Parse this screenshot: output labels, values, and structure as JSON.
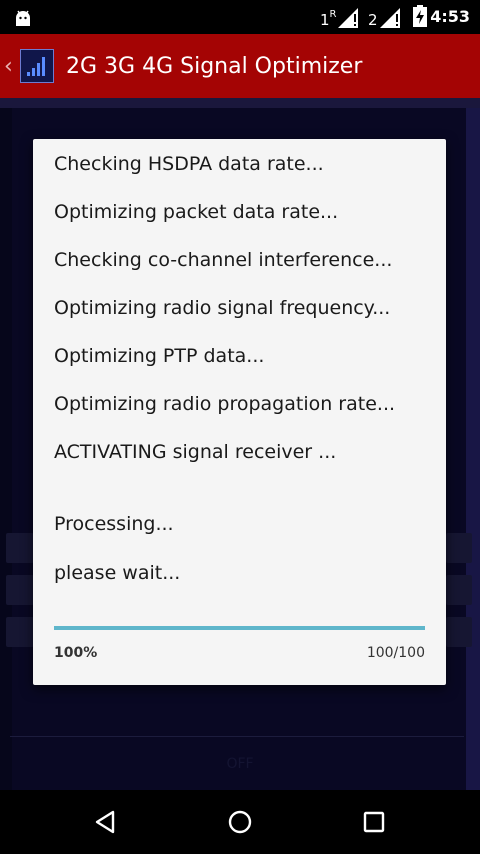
{
  "status_bar": {
    "sim1_label": "1",
    "sim1_roaming": "R",
    "sim2_label": "2",
    "time": "4:53"
  },
  "app_bar": {
    "back_glyph": "‹",
    "title": "2G 3G 4G Signal Optimizer"
  },
  "background": {
    "off_label": "OFF"
  },
  "dialog": {
    "messages": [
      "Checking HSDPA data rate...",
      "Optimizing packet data rate...",
      "Checking co-channel interference...",
      "Optimizing radio signal frequency...",
      "Optimizing PTP data...",
      "Optimizing radio propagation rate...",
      "ACTIVATING signal receiver ...",
      "Processing...",
      "please wait..."
    ],
    "progress": {
      "percent_label": "100%",
      "count_label": "100/100",
      "value": 100,
      "max": 100
    }
  },
  "colors": {
    "app_bar": "#a40404",
    "progress": "#5fb6cb",
    "dialog_bg": "#f5f5f5"
  },
  "nav_bar": {
    "back_icon": "back-triangle-icon",
    "home_icon": "home-circle-icon",
    "recents_icon": "recents-square-icon"
  }
}
